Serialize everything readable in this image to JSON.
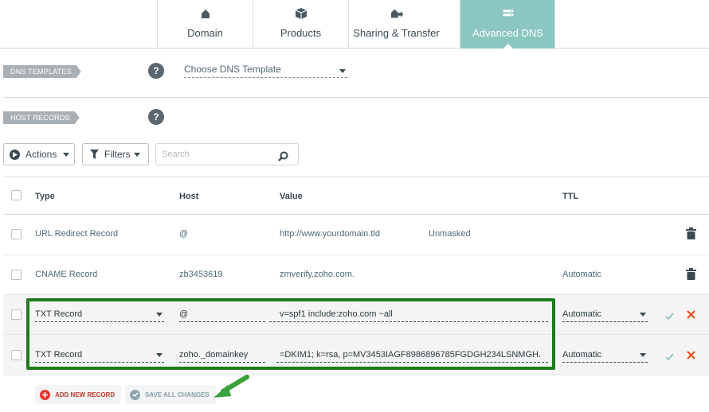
{
  "tabs": [
    {
      "label": "Domain",
      "icon": "house-icon",
      "active": false
    },
    {
      "label": "Products",
      "icon": "box-icon",
      "active": false
    },
    {
      "label": "Sharing & Transfer",
      "icon": "share-icon",
      "active": false
    },
    {
      "label": "Advanced DNS",
      "icon": "dns-icon",
      "active": true
    }
  ],
  "dns_templates": {
    "section_label": "DNS TEMPLATES",
    "help": "?",
    "select_value": "Choose DNS Template"
  },
  "host_records": {
    "section_label": "HOST RECORDS",
    "help": "?"
  },
  "toolbar": {
    "actions_label": "Actions",
    "filters_label": "Filters",
    "search_placeholder": "Search"
  },
  "table": {
    "columns": [
      "Type",
      "Host",
      "Value",
      "TTL"
    ],
    "rows": [
      {
        "type": "URL Redirect Record",
        "host": "@",
        "value": "http://www.yourdomain.tld",
        "extra": "Unmasked",
        "ttl": ""
      },
      {
        "type": "CNAME Record",
        "host": "zb3453619",
        "value": "zmverify.zoho.com.",
        "extra": "",
        "ttl": "Automatic"
      }
    ],
    "edit_rows": [
      {
        "type": "TXT Record",
        "host": "@",
        "value": "v=spf1 include:zoho.com ~all",
        "ttl": "Automatic"
      },
      {
        "type": "TXT Record",
        "host": "zoho._domainkey",
        "value": "=DKIM1; k=rsa, p=MV3453IAGF8986896785FGDGH234LSNMGH.",
        "ttl": "Automatic"
      }
    ]
  },
  "footer": {
    "add_label": "ADD NEW RECORD",
    "save_label": "SAVE ALL CHANGES"
  },
  "colors": {
    "accent_tab": "#8cc6c1",
    "highlight_border": "#1e7a1e",
    "delete_x": "#e8531f",
    "check": "#8cc6c1",
    "add_icon": "#e3342f",
    "arrow": "#3aa23a"
  }
}
